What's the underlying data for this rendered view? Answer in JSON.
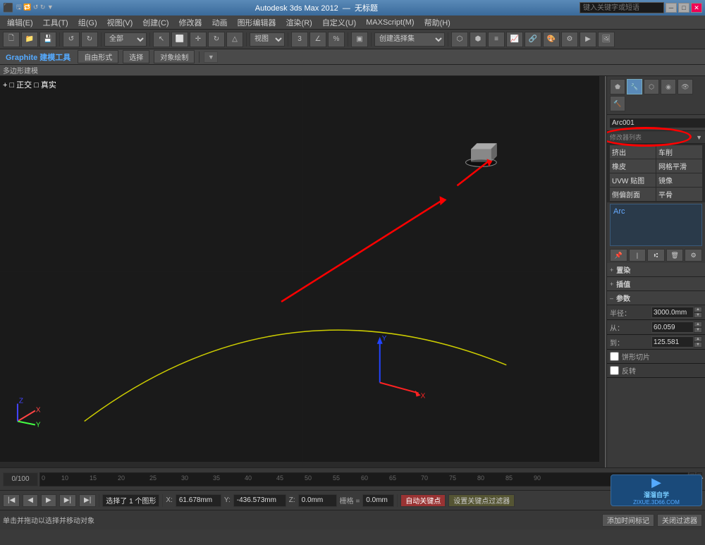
{
  "titlebar": {
    "app_title": "Autodesk 3ds Max 2012",
    "file_name": "无标题",
    "search_placeholder": "键入关键字或短语",
    "min_label": "─",
    "max_label": "□",
    "close_label": "✕"
  },
  "menubar": {
    "items": [
      {
        "label": "编辑(E)"
      },
      {
        "label": "工具(T)"
      },
      {
        "label": "组(G)"
      },
      {
        "label": "视图(V)"
      },
      {
        "label": "创建(C)"
      },
      {
        "label": "修改器"
      },
      {
        "label": "动画"
      },
      {
        "label": "图形编辑器"
      },
      {
        "label": "渲染(R)"
      },
      {
        "label": "自定义(U)"
      },
      {
        "label": "MAXScript(M)"
      },
      {
        "label": "帮助(H)"
      }
    ]
  },
  "secondary_toolbar": {
    "graphite_label": "Graphite 建模工具",
    "freeform_label": "自由形式",
    "select_label": "选择",
    "obj_paint_label": "对象绘制",
    "poly_label": "多边形建模"
  },
  "viewport": {
    "perspective_label": "+ □ 正交 □ 真实",
    "nav_items": [
      "选择",
      "自动关键点"
    ]
  },
  "right_panel": {
    "object_name": "Arc001",
    "modifier_label": "挤出",
    "modifier_label2": "车削",
    "modifier_label3": "橡皮",
    "modifier_label4": "网格平滑",
    "modifier_label5": "UVW 贴图",
    "modifier_label6": "镜像",
    "modifier_label7": "侧偏剖面",
    "modifier_label8": "平骨",
    "stack_name": "Arc",
    "render_section": "置染",
    "interp_section": "插值",
    "params_section": "参数",
    "radius_label": "半径：",
    "radius_value": "3000.0mm",
    "from_label": "从：",
    "from_value": "60.059",
    "to_label": "到：",
    "to_value": "125.581",
    "pie_check": "饼形切片",
    "reverse_check": "反转"
  },
  "timeline": {
    "current_frame": "0",
    "total_frames": "100",
    "ticks": [
      "10",
      "15",
      "20",
      "25",
      "30",
      "35",
      "40",
      "45",
      "50",
      "55",
      "60",
      "65",
      "70",
      "75",
      "80",
      "85",
      "90"
    ]
  },
  "status_bar": {
    "selected_text": "选择了 1 个图形",
    "x_label": "X:",
    "x_value": "61.678mm",
    "y_label": "Y:",
    "y_value": "-436.573mm",
    "z_label": "Z:",
    "z_value": "0.0mm",
    "grid_label": "栅格 =",
    "grid_value": "0.0mm",
    "auto_key_label": "自动关键点",
    "set_key_label": "设置关键点过滤器",
    "bottom_text": "单击并拖动以选择并移动对象",
    "add_time_tag": "添加时间标记",
    "close_filter": "关闭过滤器"
  },
  "watermark": {
    "icon": "▶",
    "text": "溜溜自学",
    "url": "ZIXUE.3D66.COM"
  },
  "annotation": {
    "circle1_note": "modifier dropdown circle",
    "arrow_note": "red arrows pointing to UI elements"
  }
}
